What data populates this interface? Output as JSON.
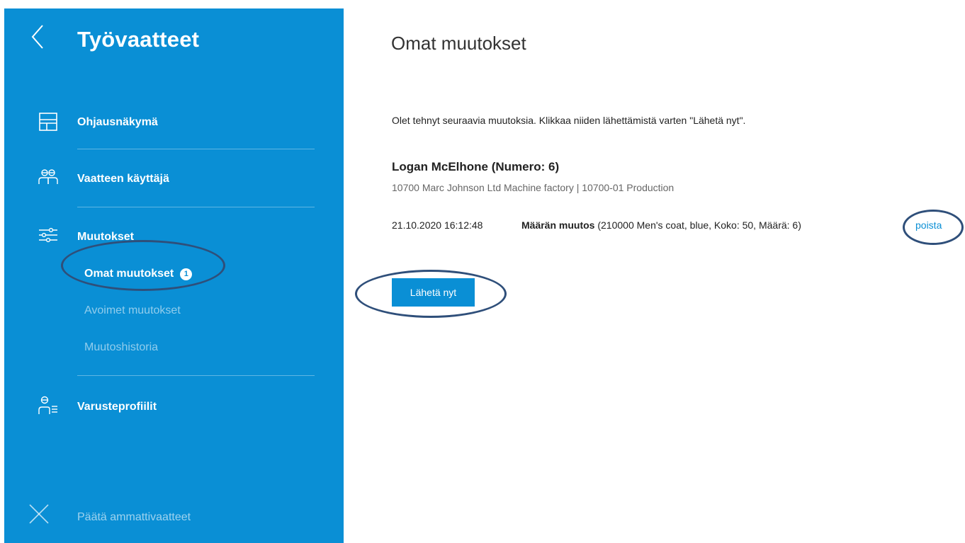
{
  "sidebar": {
    "title": "Työvaatteet",
    "nav": {
      "dashboard_label": "Ohjausnäkymä",
      "user_label": "Vaatteen käyttäjä",
      "changes_label": "Muutokset",
      "profiles_label": "Varusteprofiilit"
    },
    "changes_sub": {
      "own_label": "Omat muutokset",
      "own_badge": "1",
      "open_label": "Avoimet muutokset",
      "history_label": "Muutoshistoria"
    },
    "exit_label": "Päätä ammattivaatteet"
  },
  "main": {
    "title": "Omat muutokset",
    "intro": "Olet tehnyt seuraavia muutoksia. Klikkaa niiden lähettämistä varten \"Lähetä nyt\".",
    "person": {
      "name": "Logan McElhone (Numero: 6)",
      "org": "10700 Marc Johnson Ltd Machine factory | 10700-01 Production"
    },
    "change": {
      "timestamp": "21.10.2020 16:12:48",
      "type": "Määrän muutos",
      "details": "(210000 Men's coat, blue, Koko: 50, Määrä: 6)",
      "remove_label": "poista"
    },
    "send_label": "Lähetä nyt"
  },
  "colors": {
    "sidebar_bg": "#0a8fd5",
    "accent": "#0a8fd5",
    "annotation": "#2f4f7a"
  }
}
